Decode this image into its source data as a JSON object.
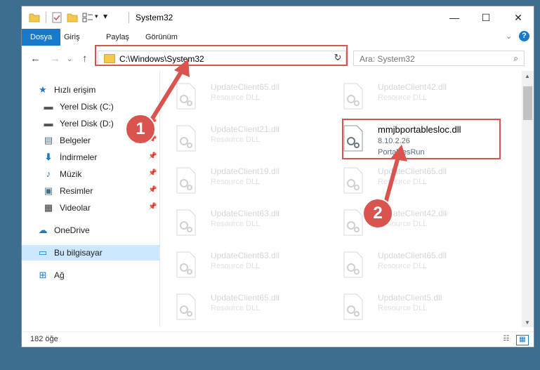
{
  "window": {
    "title": "System32"
  },
  "title_controls": {
    "minimize": "—",
    "maximize": "☐",
    "close": "✕"
  },
  "ribbon": {
    "tabs": [
      {
        "label": "Dosya",
        "active": true
      },
      {
        "label": "Giriş"
      },
      {
        "label": "Paylaş"
      },
      {
        "label": "Görünüm"
      }
    ],
    "collapse_icon": "chevron-down",
    "help_icon": "?"
  },
  "address_bar": {
    "path": "C:\\Windows\\System32",
    "refresh_icon": "↻"
  },
  "search": {
    "placeholder": "Ara: System32"
  },
  "nav": {
    "items": [
      {
        "label": "Hızlı erişim",
        "icon": "star"
      },
      {
        "label": "Yerel Disk (C:)",
        "icon": "drive"
      },
      {
        "label": "Yerel Disk (D:)",
        "icon": "drive"
      },
      {
        "label": "Belgeler",
        "icon": "document"
      },
      {
        "label": "İndirmeler",
        "icon": "download"
      },
      {
        "label": "Müzik",
        "icon": "music"
      },
      {
        "label": "Resimler",
        "icon": "pictures"
      },
      {
        "label": "Videolar",
        "icon": "video"
      },
      {
        "label": "OneDrive",
        "icon": "cloud"
      },
      {
        "label": "Bu bilgisayar",
        "icon": "computer",
        "selected": true
      },
      {
        "label": "Ağ",
        "icon": "network"
      }
    ]
  },
  "files": {
    "left": [
      {
        "name": "UpdateClient65.dll",
        "type": "Resource DLL"
      },
      {
        "name": "UpdateClient21.dll",
        "type": "Resource DLL"
      },
      {
        "name": "UpdateClient19.dll",
        "type": "Resource DLL"
      },
      {
        "name": "UpdateClient63.dll",
        "type": "Resource DLL"
      },
      {
        "name": "UpdateClient63.dll",
        "type": "Resource DLL"
      },
      {
        "name": "UpdateClient65.dll",
        "type": "Resource DLL"
      }
    ],
    "right": [
      {
        "name": "UpdateClient42.dll",
        "type": "Resource DLL"
      },
      {
        "name": "mmjbportablesloc.dll",
        "version": "8.10.2.26",
        "type": "PortablesRun",
        "highlighted": true
      },
      {
        "name": "UpdateClient65.dll",
        "type": "Resource DLL"
      },
      {
        "name": "UpdateClient42.dll",
        "type": "Resource DLL"
      },
      {
        "name": "UpdateClient65.dll",
        "type": "Resource DLL"
      },
      {
        "name": "UpdateClient5.dll",
        "type": "Resource DLL"
      }
    ]
  },
  "status": {
    "item_count": "182 öğe"
  },
  "callouts": {
    "one": "1",
    "two": "2"
  },
  "colors": {
    "accent": "#1979ca",
    "annotation": "#d9534f",
    "selection": "#cce8ff"
  }
}
